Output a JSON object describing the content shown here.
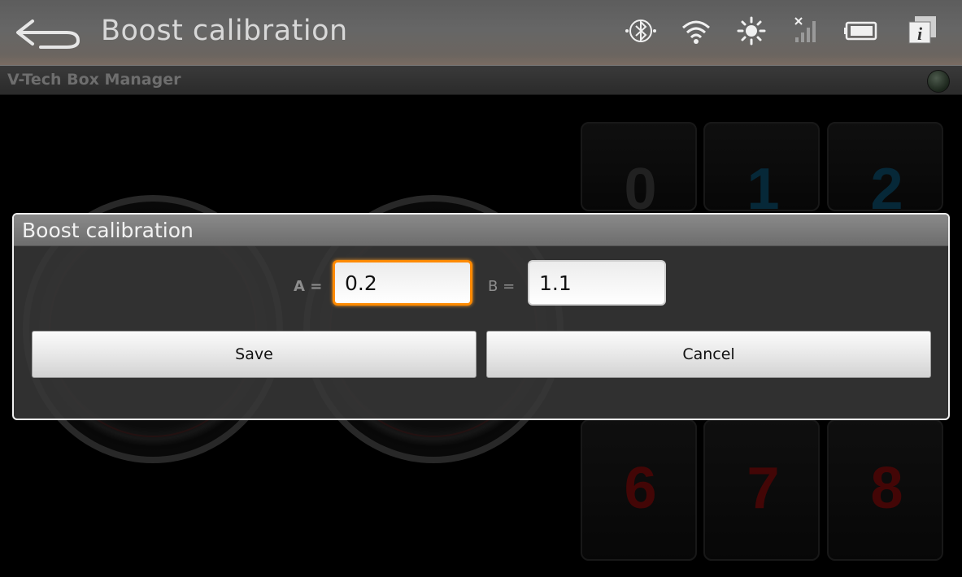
{
  "action_bar": {
    "title": "Boost calibration",
    "status_icons": [
      "bluetooth-icon",
      "wifi-icon",
      "brightness-icon",
      "signal-off-icon",
      "battery-icon",
      "info-icon"
    ]
  },
  "sub_bar": {
    "app_name": "V-Tech Box Manager"
  },
  "background": {
    "digits": [
      "0",
      "1",
      "2",
      "6",
      "7",
      "8"
    ],
    "digit_colors": [
      "#3c3c3c",
      "#0c4a66",
      "#0c4a66",
      "#7a0b0b",
      "#7a0b0b",
      "#7a0b0b"
    ]
  },
  "dialog": {
    "title": "Boost calibration",
    "label_a": "A =",
    "value_a": "0.2",
    "label_b": "B =",
    "value_b": "1.1",
    "save_label": "Save",
    "cancel_label": "Cancel"
  },
  "colors": {
    "focus_accent": "#ff8a00"
  }
}
